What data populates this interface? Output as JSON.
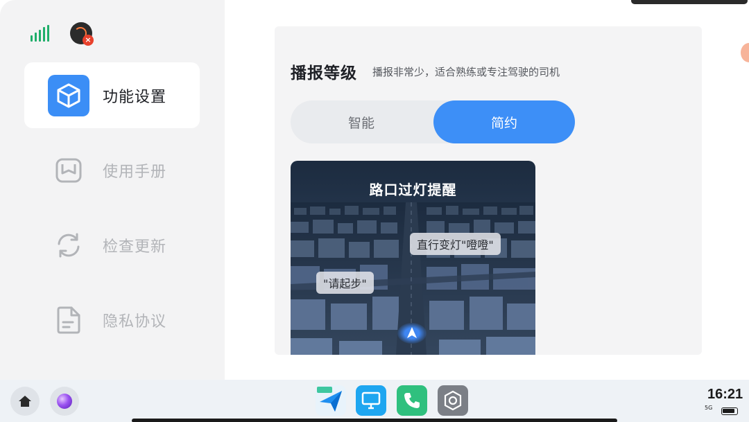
{
  "sidebar": {
    "items": [
      {
        "label": "功能设置",
        "icon": "cube-icon",
        "active": true
      },
      {
        "label": "使用手册",
        "icon": "manual-icon",
        "active": false
      },
      {
        "label": "检查更新",
        "icon": "refresh-icon",
        "active": false
      },
      {
        "label": "隐私协议",
        "icon": "document-icon",
        "active": false
      }
    ]
  },
  "main": {
    "section_title": "播报等级",
    "section_subtitle": "播报非常少，适合熟练或专注驾驶的司机",
    "segments": [
      {
        "label": "智能",
        "selected": false
      },
      {
        "label": "简约",
        "selected": true
      }
    ],
    "preview": {
      "title": "路口过灯提醒",
      "bubble_right": "直行变灯\"噔噔\"",
      "bubble_left": "\"请起步\""
    }
  },
  "status": {
    "time": "16:21",
    "network": "5G"
  },
  "taskbar": {
    "apps": [
      "home-icon",
      "assistant-orb-icon",
      "auto-navigation-app-icon",
      "screen-cast-app-icon",
      "phone-app-icon",
      "settings-app-icon"
    ]
  },
  "colors": {
    "accent": "#3d8ff7",
    "signal": "#1fae6a",
    "phone": "#2fc07e"
  }
}
